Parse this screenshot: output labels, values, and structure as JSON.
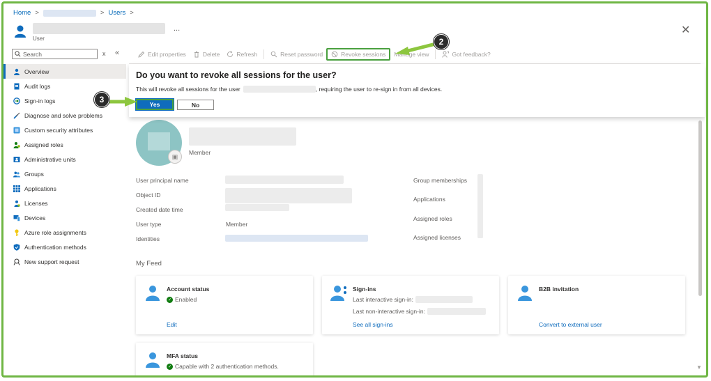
{
  "breadcrumb": {
    "home": "Home",
    "users": "Users",
    "sep": ">"
  },
  "header": {
    "subtitle": "User",
    "more": "...",
    "close": "✕"
  },
  "search": {
    "placeholder": "Search",
    "clear": "x",
    "collapse": "«"
  },
  "sidebar": {
    "items": [
      {
        "label": "Overview",
        "icon": "person-icon",
        "color": "#0f6cbd"
      },
      {
        "label": "Audit logs",
        "icon": "audit-log-icon",
        "color": "#0f6cbd"
      },
      {
        "label": "Sign-in logs",
        "icon": "sign-in-icon",
        "color": "#0f6cbd"
      },
      {
        "label": "Diagnose and solve problems",
        "icon": "wrench-icon",
        "color": "#0f6cbd"
      },
      {
        "label": "Custom security attributes",
        "icon": "attributes-icon",
        "color": "#3a96dd"
      },
      {
        "label": "Assigned roles",
        "icon": "roles-icon",
        "color": "#107c10"
      },
      {
        "label": "Administrative units",
        "icon": "admin-units-icon",
        "color": "#0f6cbd"
      },
      {
        "label": "Groups",
        "icon": "groups-icon",
        "color": "#0f6cbd"
      },
      {
        "label": "Applications",
        "icon": "grid-icon",
        "color": "#0f6cbd"
      },
      {
        "label": "Licenses",
        "icon": "license-icon",
        "color": "#0f6cbd"
      },
      {
        "label": "Devices",
        "icon": "devices-icon",
        "color": "#0f6cbd"
      },
      {
        "label": "Azure role assignments",
        "icon": "key-icon",
        "color": "#f2c811"
      },
      {
        "label": "Authentication methods",
        "icon": "shield-icon",
        "color": "#0f6cbd"
      },
      {
        "label": "New support request",
        "icon": "support-icon",
        "color": "#323130"
      }
    ]
  },
  "toolbar": {
    "edit": "Edit properties",
    "delete": "Delete",
    "refresh": "Refresh",
    "reset": "Reset password",
    "revoke": "Revoke sessions",
    "manage": "Manage view",
    "feedback": "Got feedback?"
  },
  "dialog": {
    "title": "Do you want to revoke all sessions for the user?",
    "msg_prefix": "This will revoke all sessions for the user",
    "msg_suffix": ", requiring the user to re-sign in from all devices.",
    "yes": "Yes",
    "no": "No"
  },
  "profile": {
    "role": "Member"
  },
  "properties": {
    "upn": "User principal name",
    "object_id": "Object ID",
    "created": "Created date time",
    "user_type": "User type",
    "user_type_value": "Member",
    "identities": "Identities",
    "groups": "Group memberships",
    "apps": "Applications",
    "roles": "Assigned roles",
    "licenses": "Assigned licenses"
  },
  "feed": {
    "title": "My Feed",
    "account": {
      "title": "Account status",
      "status": "Enabled",
      "link": "Edit"
    },
    "signins": {
      "title": "Sign-ins",
      "line1": "Last interactive sign-in:",
      "line2": "Last non-interactive sign-in:",
      "link": "See all sign-ins"
    },
    "b2b": {
      "title": "B2B invitation",
      "link": "Convert to external user"
    },
    "mfa": {
      "title": "MFA status",
      "status": "Capable with 2 authentication methods."
    }
  },
  "callouts": {
    "step2": "2",
    "step3": "3"
  },
  "colors": {
    "accent": "#0f6cbd",
    "highlight": "#4aa03f",
    "callout_arrow": "#8dc63f"
  }
}
